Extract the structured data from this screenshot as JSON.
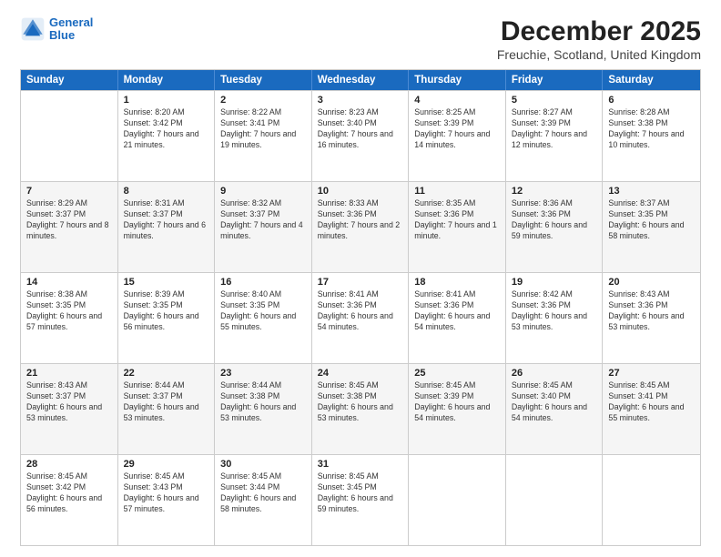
{
  "logo": {
    "line1": "General",
    "line2": "Blue"
  },
  "title": "December 2025",
  "subtitle": "Freuchie, Scotland, United Kingdom",
  "headers": [
    "Sunday",
    "Monday",
    "Tuesday",
    "Wednesday",
    "Thursday",
    "Friday",
    "Saturday"
  ],
  "weeks": [
    [
      {
        "day": "",
        "sunrise": "",
        "sunset": "",
        "daylight": ""
      },
      {
        "day": "1",
        "sunrise": "Sunrise: 8:20 AM",
        "sunset": "Sunset: 3:42 PM",
        "daylight": "Daylight: 7 hours and 21 minutes."
      },
      {
        "day": "2",
        "sunrise": "Sunrise: 8:22 AM",
        "sunset": "Sunset: 3:41 PM",
        "daylight": "Daylight: 7 hours and 19 minutes."
      },
      {
        "day": "3",
        "sunrise": "Sunrise: 8:23 AM",
        "sunset": "Sunset: 3:40 PM",
        "daylight": "Daylight: 7 hours and 16 minutes."
      },
      {
        "day": "4",
        "sunrise": "Sunrise: 8:25 AM",
        "sunset": "Sunset: 3:39 PM",
        "daylight": "Daylight: 7 hours and 14 minutes."
      },
      {
        "day": "5",
        "sunrise": "Sunrise: 8:27 AM",
        "sunset": "Sunset: 3:39 PM",
        "daylight": "Daylight: 7 hours and 12 minutes."
      },
      {
        "day": "6",
        "sunrise": "Sunrise: 8:28 AM",
        "sunset": "Sunset: 3:38 PM",
        "daylight": "Daylight: 7 hours and 10 minutes."
      }
    ],
    [
      {
        "day": "7",
        "sunrise": "Sunrise: 8:29 AM",
        "sunset": "Sunset: 3:37 PM",
        "daylight": "Daylight: 7 hours and 8 minutes."
      },
      {
        "day": "8",
        "sunrise": "Sunrise: 8:31 AM",
        "sunset": "Sunset: 3:37 PM",
        "daylight": "Daylight: 7 hours and 6 minutes."
      },
      {
        "day": "9",
        "sunrise": "Sunrise: 8:32 AM",
        "sunset": "Sunset: 3:37 PM",
        "daylight": "Daylight: 7 hours and 4 minutes."
      },
      {
        "day": "10",
        "sunrise": "Sunrise: 8:33 AM",
        "sunset": "Sunset: 3:36 PM",
        "daylight": "Daylight: 7 hours and 2 minutes."
      },
      {
        "day": "11",
        "sunrise": "Sunrise: 8:35 AM",
        "sunset": "Sunset: 3:36 PM",
        "daylight": "Daylight: 7 hours and 1 minute."
      },
      {
        "day": "12",
        "sunrise": "Sunrise: 8:36 AM",
        "sunset": "Sunset: 3:36 PM",
        "daylight": "Daylight: 6 hours and 59 minutes."
      },
      {
        "day": "13",
        "sunrise": "Sunrise: 8:37 AM",
        "sunset": "Sunset: 3:35 PM",
        "daylight": "Daylight: 6 hours and 58 minutes."
      }
    ],
    [
      {
        "day": "14",
        "sunrise": "Sunrise: 8:38 AM",
        "sunset": "Sunset: 3:35 PM",
        "daylight": "Daylight: 6 hours and 57 minutes."
      },
      {
        "day": "15",
        "sunrise": "Sunrise: 8:39 AM",
        "sunset": "Sunset: 3:35 PM",
        "daylight": "Daylight: 6 hours and 56 minutes."
      },
      {
        "day": "16",
        "sunrise": "Sunrise: 8:40 AM",
        "sunset": "Sunset: 3:35 PM",
        "daylight": "Daylight: 6 hours and 55 minutes."
      },
      {
        "day": "17",
        "sunrise": "Sunrise: 8:41 AM",
        "sunset": "Sunset: 3:36 PM",
        "daylight": "Daylight: 6 hours and 54 minutes."
      },
      {
        "day": "18",
        "sunrise": "Sunrise: 8:41 AM",
        "sunset": "Sunset: 3:36 PM",
        "daylight": "Daylight: 6 hours and 54 minutes."
      },
      {
        "day": "19",
        "sunrise": "Sunrise: 8:42 AM",
        "sunset": "Sunset: 3:36 PM",
        "daylight": "Daylight: 6 hours and 53 minutes."
      },
      {
        "day": "20",
        "sunrise": "Sunrise: 8:43 AM",
        "sunset": "Sunset: 3:36 PM",
        "daylight": "Daylight: 6 hours and 53 minutes."
      }
    ],
    [
      {
        "day": "21",
        "sunrise": "Sunrise: 8:43 AM",
        "sunset": "Sunset: 3:37 PM",
        "daylight": "Daylight: 6 hours and 53 minutes."
      },
      {
        "day": "22",
        "sunrise": "Sunrise: 8:44 AM",
        "sunset": "Sunset: 3:37 PM",
        "daylight": "Daylight: 6 hours and 53 minutes."
      },
      {
        "day": "23",
        "sunrise": "Sunrise: 8:44 AM",
        "sunset": "Sunset: 3:38 PM",
        "daylight": "Daylight: 6 hours and 53 minutes."
      },
      {
        "day": "24",
        "sunrise": "Sunrise: 8:45 AM",
        "sunset": "Sunset: 3:38 PM",
        "daylight": "Daylight: 6 hours and 53 minutes."
      },
      {
        "day": "25",
        "sunrise": "Sunrise: 8:45 AM",
        "sunset": "Sunset: 3:39 PM",
        "daylight": "Daylight: 6 hours and 54 minutes."
      },
      {
        "day": "26",
        "sunrise": "Sunrise: 8:45 AM",
        "sunset": "Sunset: 3:40 PM",
        "daylight": "Daylight: 6 hours and 54 minutes."
      },
      {
        "day": "27",
        "sunrise": "Sunrise: 8:45 AM",
        "sunset": "Sunset: 3:41 PM",
        "daylight": "Daylight: 6 hours and 55 minutes."
      }
    ],
    [
      {
        "day": "28",
        "sunrise": "Sunrise: 8:45 AM",
        "sunset": "Sunset: 3:42 PM",
        "daylight": "Daylight: 6 hours and 56 minutes."
      },
      {
        "day": "29",
        "sunrise": "Sunrise: 8:45 AM",
        "sunset": "Sunset: 3:43 PM",
        "daylight": "Daylight: 6 hours and 57 minutes."
      },
      {
        "day": "30",
        "sunrise": "Sunrise: 8:45 AM",
        "sunset": "Sunset: 3:44 PM",
        "daylight": "Daylight: 6 hours and 58 minutes."
      },
      {
        "day": "31",
        "sunrise": "Sunrise: 8:45 AM",
        "sunset": "Sunset: 3:45 PM",
        "daylight": "Daylight: 6 hours and 59 minutes."
      },
      {
        "day": "",
        "sunrise": "",
        "sunset": "",
        "daylight": ""
      },
      {
        "day": "",
        "sunrise": "",
        "sunset": "",
        "daylight": ""
      },
      {
        "day": "",
        "sunrise": "",
        "sunset": "",
        "daylight": ""
      }
    ]
  ]
}
